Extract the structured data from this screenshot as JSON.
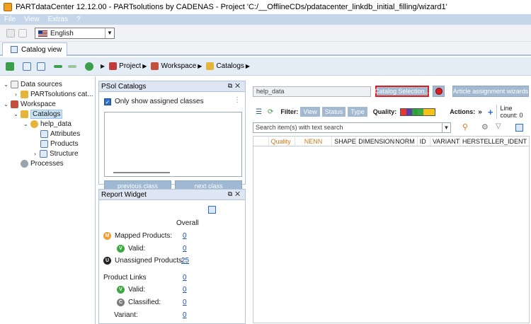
{
  "window": {
    "title": "PARTdataCenter 12.12.00 - PARTsolutions by CADENAS - Project 'C:/__OfflineCDs/pdatacenter_linkdb_initial_filling/wizard1'"
  },
  "menu": [
    "File",
    "View",
    "Extras",
    "?"
  ],
  "language": {
    "selected": "English"
  },
  "tab": {
    "label": "Catalog view"
  },
  "breadcrumb": {
    "project": "Project",
    "workspace": "Workspace",
    "catalogs": "Catalogs"
  },
  "tree": {
    "data_sources": "Data sources",
    "partsolutions": "PARTsolutions cat...",
    "workspace": "Workspace",
    "catalogs": "Catalogs",
    "help_data": "help_data",
    "attributes": "Attributes",
    "products": "Products",
    "structure": "Structure",
    "processes": "Processes"
  },
  "psol": {
    "title": "PSol Catalogs",
    "checkbox_label": "Only show assigned classes",
    "prev": "previous class",
    "next": "next class"
  },
  "report": {
    "title": "Report Widget",
    "overall": "Overall",
    "mapped": "Mapped Products:",
    "mapped_value": "0",
    "valid": "Valid:",
    "valid_value": "0",
    "unassigned": "Unassigned Products:",
    "unassigned_value": "25",
    "product_links": "Product Links",
    "pl_value": "0",
    "pl_valid": "Valid:",
    "pl_valid_value": "0",
    "classified": "Classified:",
    "classified_value": "0",
    "variant": "Variant:",
    "variant_value": "0"
  },
  "main": {
    "catalog_field": "help_data",
    "catalog_selection": "Catalog Selection...",
    "article_wizards": "Article assignment wizards",
    "filter_label": "Filter:",
    "filter_view": "View",
    "filter_status": "Status",
    "filter_type": "Type",
    "quality_label": "Quality:",
    "actions_label": "Actions:",
    "actions_more": "»",
    "line_count": "Line count: 0",
    "search_placeholder": "Search item(s) with text search",
    "columns": [
      "Quality",
      "NENN",
      "SHAPE",
      "DIMENSION",
      "NORM",
      "ID",
      "VARIANT",
      "HERSTELLER_IDENT"
    ]
  },
  "colors": {
    "accent": "#2d6fc7",
    "button_bg": "#a3b8d1",
    "highlight_border": "#e11d1d",
    "quality_bar": [
      "#e53935",
      "#5a3fa8",
      "#2f9e3e",
      "#3aaa3f",
      "#f2c21b",
      "#f2c21b"
    ]
  }
}
